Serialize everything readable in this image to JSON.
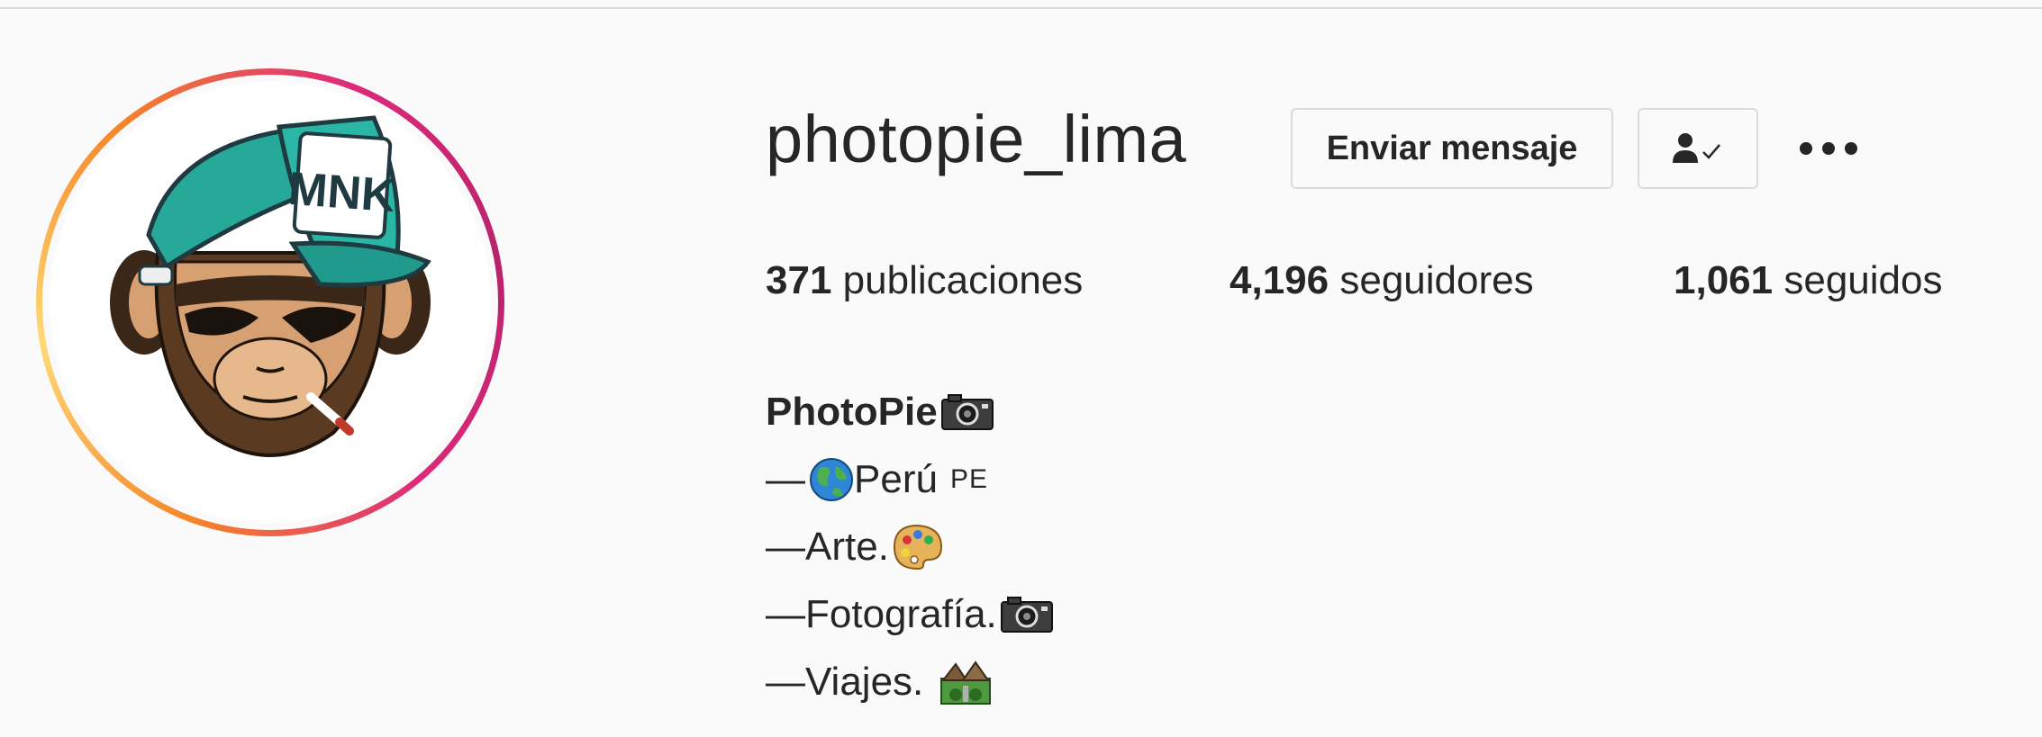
{
  "profile": {
    "username": "photopie_lima",
    "avatar_text": "MNK",
    "actions": {
      "message_label": "Enviar mensaje",
      "follow_icon": "person-check-icon",
      "more_icon": "more-horizontal-icon"
    },
    "stats": {
      "posts_count": "371",
      "posts_label": "publicaciones",
      "followers_count": "4,196",
      "followers_label": "seguidores",
      "following_count": "1,061",
      "following_label": "seguidos"
    },
    "bio": {
      "name": "PhotoPie",
      "lines": [
        {
          "text": "Perú",
          "prefix": "—",
          "suffix": "PE",
          "emoji": "globe-icon"
        },
        {
          "text": "Arte.",
          "prefix": "—",
          "emoji": "palette-icon"
        },
        {
          "text": "Fotografía.",
          "prefix": "—",
          "emoji": "camera-icon"
        },
        {
          "text": "Viajes.",
          "prefix": "—",
          "emoji": "national-park-icon"
        }
      ]
    }
  },
  "colors": {
    "background": "#fafafa",
    "text": "#262626",
    "border": "#dbdbdb",
    "ring_start": "#f58529",
    "ring_end": "#dd2a7b"
  }
}
